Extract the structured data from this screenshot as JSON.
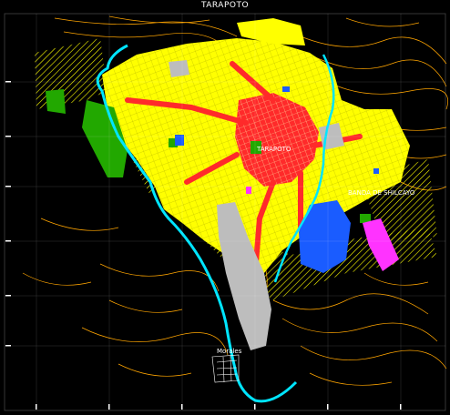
{
  "map": {
    "title": "TARAPOTO",
    "labels": {
      "center": "TARAPOTO",
      "district_east": "BANDA DE SHILCAYO",
      "lower": "Morales"
    },
    "colors": {
      "background": "#000000",
      "river": "#00e5ff",
      "residential": "#ffff00",
      "central_core": "#ff2a2a",
      "green_area": "#22a800",
      "blue_zone": "#1a5cff",
      "industrial": "#ff33ff",
      "airport": "#bdbdbd",
      "contours": "#ffa500",
      "hatch": "#ffff00",
      "grid": "#ffffff"
    },
    "grid_ticks": {
      "left": [
        "",
        "",
        "",
        "",
        "",
        "",
        "",
        ""
      ],
      "bottom": [
        "",
        "",
        "",
        "",
        "",
        "",
        "",
        "",
        "",
        "",
        "",
        ""
      ]
    }
  }
}
